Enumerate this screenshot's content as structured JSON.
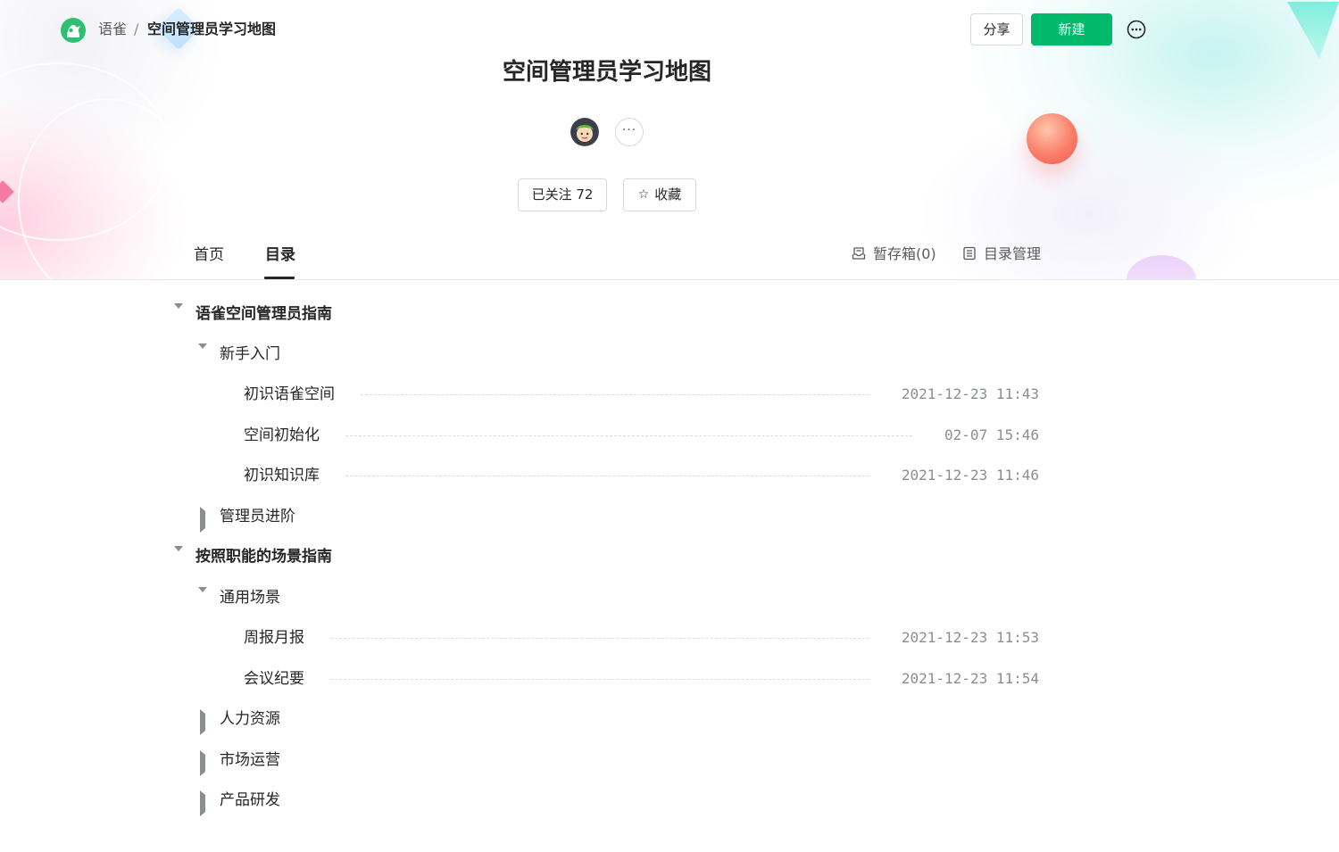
{
  "breadcrumb": {
    "home": "语雀",
    "separator": "/",
    "current": "空间管理员学习地图"
  },
  "header": {
    "share_label": "分享",
    "new_label": "新建",
    "more_icon": "ellipsis-circle-icon"
  },
  "book": {
    "title": "空间管理员学习地图",
    "more_label": "···",
    "follow_label": "已关注 72",
    "star_label": "收藏"
  },
  "tabs": [
    {
      "label": "首页",
      "active": false
    },
    {
      "label": "目录",
      "active": true
    }
  ],
  "tools": {
    "drafts_label": "暂存箱(0)",
    "manage_label": "目录管理"
  },
  "toc": [
    {
      "level": 1,
      "expanded": true,
      "label": "语雀空间管理员指南"
    },
    {
      "level": 2,
      "expanded": true,
      "label": "新手入门"
    },
    {
      "level": 3,
      "label": "初识语雀空间",
      "date": "2021-12-23 11:43"
    },
    {
      "level": 3,
      "label": "空间初始化",
      "date": "02-07 15:46"
    },
    {
      "level": 3,
      "label": "初识知识库",
      "date": "2021-12-23 11:46"
    },
    {
      "level": 2,
      "expanded": false,
      "label": "管理员进阶"
    },
    {
      "level": 1,
      "expanded": true,
      "label": "按照职能的场景指南"
    },
    {
      "level": 2,
      "expanded": true,
      "label": "通用场景"
    },
    {
      "level": 3,
      "label": "周报月报",
      "date": "2021-12-23 11:53"
    },
    {
      "level": 3,
      "label": "会议纪要",
      "date": "2021-12-23 11:54"
    },
    {
      "level": 2,
      "expanded": false,
      "label": "人力资源"
    },
    {
      "level": 2,
      "expanded": false,
      "label": "市场运营"
    },
    {
      "level": 2,
      "expanded": false,
      "label": "产品研发"
    }
  ],
  "colors": {
    "primary_green": "#00b96b",
    "text": "#262626",
    "muted": "#8a8f8d",
    "border": "#d9d9d9"
  }
}
